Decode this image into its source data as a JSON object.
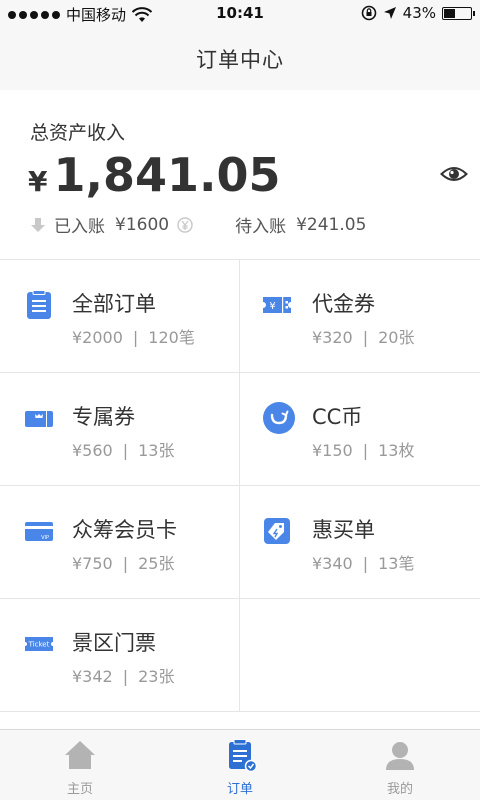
{
  "status_bar": {
    "carrier": "中国移动",
    "time": "10:41",
    "battery": "43%",
    "battery_level": 0.43
  },
  "nav": {
    "title": "订单中心"
  },
  "assets": {
    "label": "总资产收入",
    "currency": "¥",
    "amount": "1,841.05",
    "received_label": "已入账",
    "received_value": "¥1600",
    "pending_label": "待入账",
    "pending_value": "¥241.05"
  },
  "grid": [
    {
      "title": "全部订单",
      "amount": "¥2000",
      "sep": "|",
      "count": "120笔",
      "icon": "clipboard-icon"
    },
    {
      "title": "代金券",
      "amount": "¥320",
      "sep": "|",
      "count": "20张",
      "icon": "voucher-icon"
    },
    {
      "title": "专属券",
      "amount": "¥560",
      "sep": "|",
      "count": "13张",
      "icon": "exclusive-coupon-icon"
    },
    {
      "title": "CC币",
      "amount": "¥150",
      "sep": "|",
      "count": "13枚",
      "icon": "cc-coin-icon"
    },
    {
      "title": "众筹会员卡",
      "amount": "¥750",
      "sep": "|",
      "count": "25张",
      "icon": "vip-card-icon",
      "icon_text": "VIP"
    },
    {
      "title": "惠买单",
      "amount": "¥340",
      "sep": "|",
      "count": "13笔",
      "icon": "discount-tag-icon"
    },
    {
      "title": "景区门票",
      "amount": "¥342",
      "sep": "|",
      "count": "23张",
      "icon": "ticket-icon",
      "icon_text": "Ticket"
    }
  ],
  "tabs": [
    {
      "label": "主页",
      "icon": "home-icon",
      "active": false
    },
    {
      "label": "订单",
      "icon": "order-icon",
      "active": true
    },
    {
      "label": "我的",
      "icon": "profile-icon",
      "active": false
    }
  ],
  "colors": {
    "accent": "#2e6fd3",
    "icon_blue": "#4a86e8",
    "text": "#333333",
    "muted": "#999999"
  }
}
